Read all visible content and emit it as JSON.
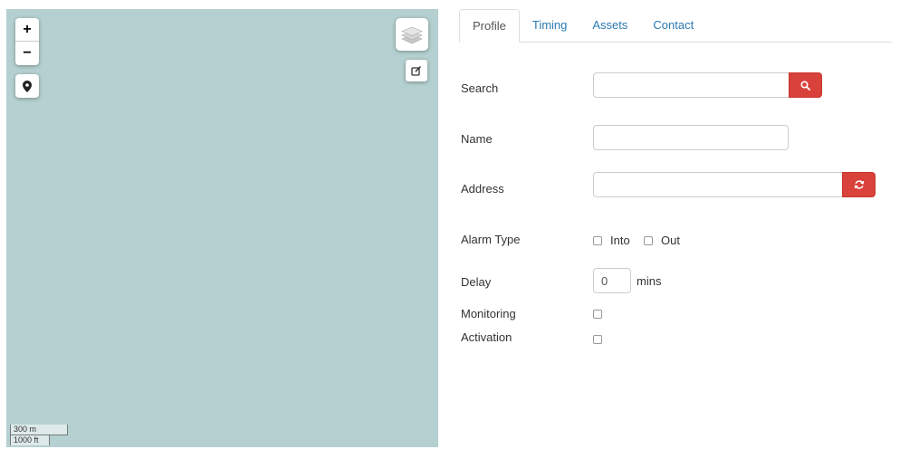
{
  "map": {
    "zoom_in_label": "+",
    "zoom_out_label": "−",
    "scale_metric": "300 m",
    "scale_imperial": "1000 ft",
    "water_color": "#b5d0d0"
  },
  "tabs": [
    {
      "label": "Profile",
      "active": true
    },
    {
      "label": "Timing",
      "active": false
    },
    {
      "label": "Assets",
      "active": false
    },
    {
      "label": "Contact",
      "active": false
    }
  ],
  "form": {
    "search_label": "Search",
    "search_value": "",
    "name_label": "Name",
    "name_value": "",
    "address_label": "Address",
    "address_value": "",
    "alarm_type_label": "Alarm Type",
    "alarm_into_label": "Into",
    "alarm_into_checked": false,
    "alarm_out_label": "Out",
    "alarm_out_checked": false,
    "delay_label": "Delay",
    "delay_value": "0",
    "delay_unit": "mins",
    "monitoring_label": "Monitoring",
    "monitoring_checked": false,
    "activation_label": "Activation",
    "activation_checked": false
  },
  "icons": {
    "zoom_in": "plus-icon",
    "zoom_out": "minus-icon",
    "locate": "map-marker-icon",
    "layers": "layers-icon",
    "edit": "edit-icon",
    "search": "search-icon",
    "refresh": "refresh-icon"
  },
  "colors": {
    "accent_link": "#2a7ab0",
    "button_danger": "#d9413b"
  }
}
